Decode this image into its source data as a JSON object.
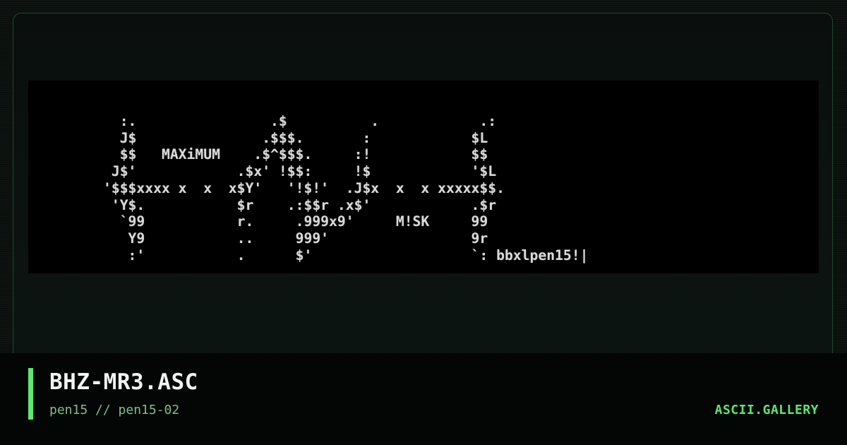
{
  "card": {
    "filename": "BHZ-MR3.ASC",
    "subtitle": "pen15 // pen15-02",
    "brand": "ASCII.GALLERY"
  },
  "artwork": {
    "text": "  :.                .$          .            .:\n  J$               .$$$.       :            $L\n  $$   MAXiMUM    .$^$$$.     :!            $$\n J$'            .$x' !$$:     !$            '$L\n'$$$xxxx x  x  x$Y'   '!$!'  .J$x  x  x xxxxx$$.\n 'Y$.           $r    .:$$r .x$'            .$r\n  `99           r.     .999x9'     M!SK     99\n   Y9           ..     999'                 9r\n   :'           .      $'                   `: bbxlpen15!|"
  },
  "colors": {
    "accent": "#5ee86f",
    "frame_border": "#1e4a26",
    "art_text": "#d9d9d9",
    "art_background": "#000000"
  }
}
